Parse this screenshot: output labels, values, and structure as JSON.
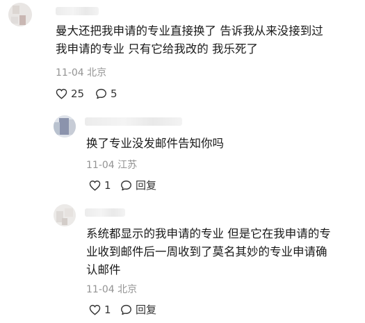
{
  "comments": [
    {
      "text_lines": [
        "曼大还把我申请的专业直接换了 告诉我从来没接到过",
        "我申请的专业 只有它给我改的 我乐死了"
      ],
      "meta": "11-04 北京",
      "like_count": "25",
      "reply_count": "5"
    }
  ],
  "replies": [
    {
      "text_lines": [
        "换了专业没发邮件告知你吗"
      ],
      "meta": "11-04 江苏",
      "like_count": "1",
      "reply_label": "回复"
    },
    {
      "text_lines": [
        "系统都显示的我申请的专业 但是它在我申请的专",
        "业收到邮件后一周收到了莫名其妙的专业申请确",
        "认邮件"
      ],
      "meta": "11-04 北京",
      "like_count": "1",
      "reply_label": "回复"
    }
  ],
  "icons": {
    "like": "heart-outline-icon",
    "comment": "speech-bubble-icon"
  }
}
